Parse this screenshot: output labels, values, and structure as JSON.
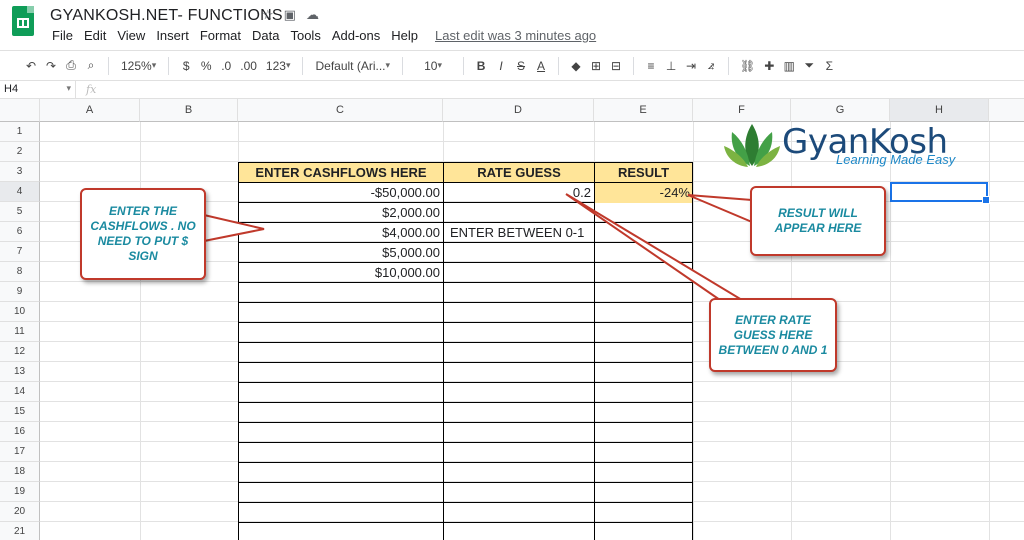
{
  "app": {
    "title": "GYANKOSH.NET- FUNCTIONS",
    "menu": [
      "File",
      "Edit",
      "View",
      "Insert",
      "Format",
      "Data",
      "Tools",
      "Add-ons",
      "Help"
    ],
    "last_edit": "Last edit was 3 minutes ago"
  },
  "toolbar": {
    "zoom": "125%",
    "currency": "$",
    "percent": "%",
    "dec_decrease": ".0",
    "dec_increase": ".00",
    "more_formats": "123",
    "font": "Default (Ari...",
    "font_size": "10",
    "bold": "B",
    "italic": "I",
    "strike": "S",
    "text_color": "A",
    "sum": "Σ"
  },
  "formula_bar": {
    "cell_ref": "H4",
    "fx": "fx"
  },
  "columns": [
    "A",
    "B",
    "C",
    "D",
    "E",
    "F",
    "G",
    "H"
  ],
  "rows": [
    "1",
    "2",
    "3",
    "4",
    "5",
    "6",
    "7",
    "8",
    "9",
    "10",
    "11",
    "12",
    "13",
    "14",
    "15",
    "16",
    "17",
    "18",
    "19",
    "20",
    "21"
  ],
  "table": {
    "headers": {
      "cashflows": "ENTER CASHFLOWS HERE",
      "rate": "RATE GUESS",
      "result": "RESULT"
    },
    "cashflows": [
      "-$50,000.00",
      "$2,000.00",
      "$4,000.00",
      "$5,000.00",
      "$10,000.00"
    ],
    "rate_guess": "0.2",
    "rate_note": "ENTER BETWEEN 0-1",
    "result": "-24%"
  },
  "callouts": {
    "cashflows": "ENTER THE CASHFLOWS . NO NEED TO PUT $ SIGN",
    "result": "RESULT WILL APPEAR HERE",
    "rate": "ENTER RATE GUESS HERE BETWEEN 0 AND 1"
  },
  "logo": {
    "name": "GyanKosh",
    "tagline": "Learning Made Easy"
  },
  "colors": {
    "header_fill": "#ffe599",
    "callout_border": "#c0392b",
    "callout_text": "#1a8aa0",
    "selection": "#1a73e8"
  }
}
